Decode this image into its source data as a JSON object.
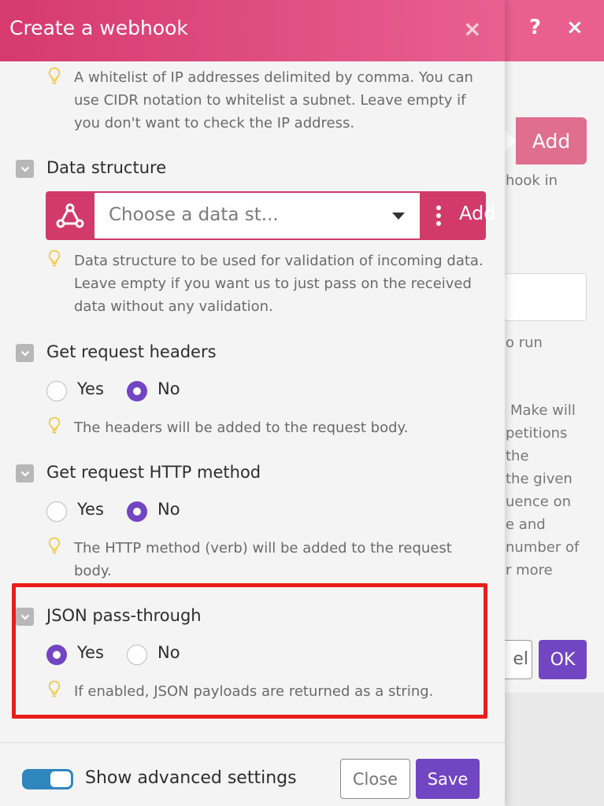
{
  "background_dialog": {
    "add_label": "Add",
    "text_fragments": [
      "hook in",
      "o run",
      "Make will",
      "petitions",
      "the",
      "the given",
      "uence on",
      "e and",
      "number of",
      "r more"
    ],
    "cancel_fragment": "el",
    "ok_label": "OK",
    "help_icon": "?",
    "close_icon": "×"
  },
  "dialog": {
    "title": "Create a webhook",
    "close_icon": "×",
    "ip_hint": [
      "A whitelist of IP addresses delimited by comma. You can",
      "use CIDR notation to whitelist a subnet. Leave empty if",
      "you don't want to check the IP address."
    ],
    "data_structure": {
      "label": "Data structure",
      "placeholder": "Choose a data st...",
      "add_label": "Add",
      "hint": [
        "Data structure to be used for validation of incoming data.",
        "Leave empty if you want us to just pass on the received",
        "data without any validation."
      ]
    },
    "request_headers": {
      "label": "Get request headers",
      "yes": "Yes",
      "no": "No",
      "selected": "No",
      "hint": "The headers will be added to the request body."
    },
    "http_method": {
      "label": "Get request HTTP method",
      "yes": "Yes",
      "no": "No",
      "selected": "No",
      "hint": [
        "The HTTP method (verb) will be added to the request",
        "body."
      ]
    },
    "json_passthrough": {
      "label": "JSON pass-through",
      "yes": "Yes",
      "no": "No",
      "selected": "Yes",
      "hint": "If enabled, JSON payloads are returned as a string."
    },
    "footer": {
      "advanced_label": "Show advanced settings",
      "advanced_on": true,
      "close_label": "Close",
      "save_label": "Save"
    }
  },
  "colors": {
    "header_accent": "#d63a6f",
    "primary_purple": "#7245c2",
    "highlight_red": "#ea1c1c",
    "toggle_blue": "#2f86be"
  }
}
